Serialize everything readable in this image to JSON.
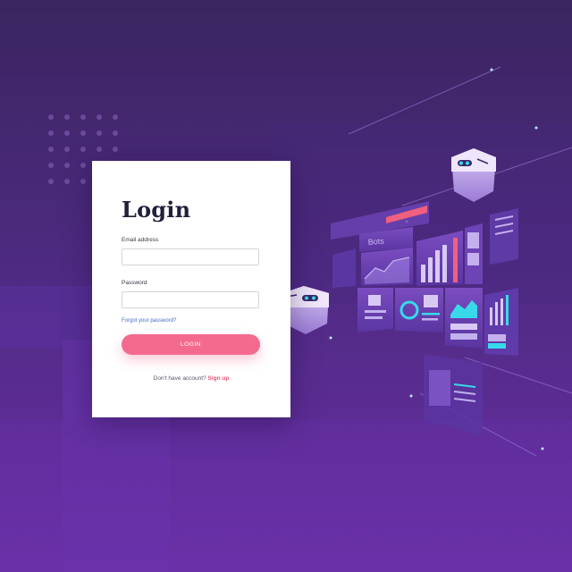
{
  "login": {
    "title": "Login",
    "email_label": "Email address",
    "email_value": "",
    "password_label": "Password",
    "password_value": "",
    "forgot_link": "Forgot your password?",
    "login_button": "LOGIN",
    "signup_prompt": "Don't have account?",
    "signup_link": "Sign up"
  },
  "illustration": {
    "panel_label": "Bots"
  },
  "colors": {
    "bg_top": "#3a2560",
    "bg_bottom": "#6a2fa6",
    "accent_pink": "#f46a8e",
    "link_blue": "#4a6bc8",
    "cyan": "#38d9e8"
  },
  "icons": [
    "robot-head-icon",
    "bar-chart-icon",
    "line-chart-icon",
    "donut-chart-icon"
  ]
}
